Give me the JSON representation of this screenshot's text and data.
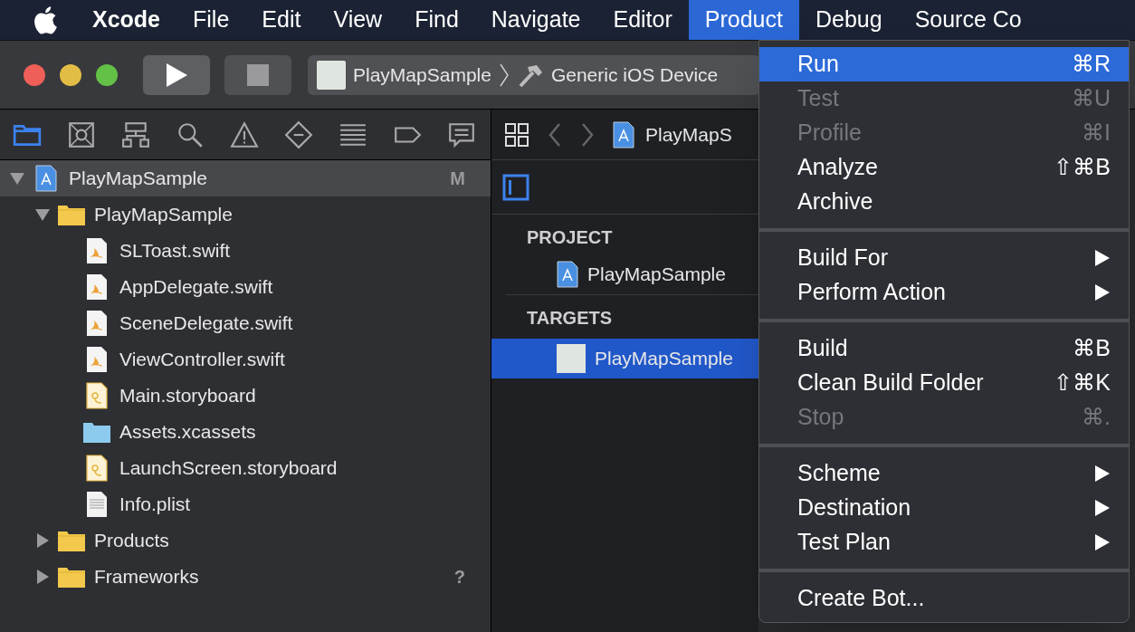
{
  "menu_bar": {
    "items": [
      {
        "label": "Xcode",
        "kind": "app",
        "selected": false
      },
      {
        "label": "File",
        "kind": "menu",
        "selected": false
      },
      {
        "label": "Edit",
        "kind": "menu",
        "selected": false
      },
      {
        "label": "View",
        "kind": "menu",
        "selected": false
      },
      {
        "label": "Find",
        "kind": "menu",
        "selected": false
      },
      {
        "label": "Navigate",
        "kind": "menu",
        "selected": false
      },
      {
        "label": "Editor",
        "kind": "menu",
        "selected": false
      },
      {
        "label": "Product",
        "kind": "menu",
        "selected": true
      },
      {
        "label": "Debug",
        "kind": "menu",
        "selected": false
      },
      {
        "label": "Source Co",
        "kind": "menu",
        "selected": false
      }
    ]
  },
  "toolbar": {
    "scheme": "PlayMapSample",
    "destination": "Generic iOS Device"
  },
  "navigator": {
    "tabs": [
      {
        "kind": "folder",
        "selected": true
      },
      {
        "kind": "source-control",
        "selected": false
      },
      {
        "kind": "hierarchy",
        "selected": false
      },
      {
        "kind": "search",
        "selected": false
      },
      {
        "kind": "warning",
        "selected": false
      },
      {
        "kind": "test",
        "selected": false
      },
      {
        "kind": "debug",
        "selected": false
      },
      {
        "kind": "breakpoint",
        "selected": false
      },
      {
        "kind": "report",
        "selected": false
      }
    ],
    "tree": [
      {
        "label": "PlayMapSample",
        "kind": "project",
        "badge": "M",
        "expanded": true,
        "selected": true,
        "children": [
          {
            "label": "PlayMapSample",
            "kind": "folder",
            "expanded": true,
            "selected": false,
            "children": [
              {
                "label": "SLToast.swift",
                "kind": "swift",
                "selected": false
              },
              {
                "label": "AppDelegate.swift",
                "kind": "swift",
                "selected": false
              },
              {
                "label": "SceneDelegate.swift",
                "kind": "swift",
                "selected": false
              },
              {
                "label": "ViewController.swift",
                "kind": "swift",
                "selected": false
              },
              {
                "label": "Main.storyboard",
                "kind": "storyboard",
                "selected": false
              },
              {
                "label": "Assets.xcassets",
                "kind": "assets",
                "selected": false
              },
              {
                "label": "LaunchScreen.storyboard",
                "kind": "storyboard",
                "selected": false
              },
              {
                "label": "Info.plist",
                "kind": "plist",
                "selected": false
              }
            ]
          },
          {
            "label": "Products",
            "kind": "folder",
            "expanded": false,
            "selected": false
          },
          {
            "label": "Frameworks",
            "kind": "folder",
            "badge": "?",
            "expanded": false,
            "selected": false
          }
        ]
      }
    ]
  },
  "editor": {
    "jump_bar": {
      "path": "PlayMapS"
    },
    "sections": [
      {
        "title": "PROJECT",
        "items": [
          {
            "label": "PlayMapSample",
            "kind": "project",
            "selected": false
          }
        ]
      },
      {
        "title": "TARGETS",
        "items": [
          {
            "label": "PlayMapSample",
            "kind": "target",
            "selected": true
          }
        ]
      }
    ]
  },
  "product_menu": {
    "items": [
      {
        "kind": "item",
        "label": "Run",
        "shortcut": "⌘R",
        "disabled": false,
        "selected": true,
        "submenu": false
      },
      {
        "kind": "item",
        "label": "Test",
        "shortcut": "⌘U",
        "disabled": true,
        "selected": false,
        "submenu": false
      },
      {
        "kind": "item",
        "label": "Profile",
        "shortcut": "⌘I",
        "disabled": true,
        "selected": false,
        "submenu": false
      },
      {
        "kind": "item",
        "label": "Analyze",
        "shortcut": "⇧⌘B",
        "disabled": false,
        "selected": false,
        "submenu": false
      },
      {
        "kind": "item",
        "label": "Archive",
        "disabled": false,
        "selected": false,
        "submenu": false
      },
      {
        "kind": "separator"
      },
      {
        "kind": "item",
        "label": "Build For",
        "disabled": false,
        "selected": false,
        "submenu": true
      },
      {
        "kind": "item",
        "label": "Perform Action",
        "disabled": false,
        "selected": false,
        "submenu": true
      },
      {
        "kind": "separator"
      },
      {
        "kind": "item",
        "label": "Build",
        "shortcut": "⌘B",
        "disabled": false,
        "selected": false,
        "submenu": false
      },
      {
        "kind": "item",
        "label": "Clean Build Folder",
        "shortcut": "⇧⌘K",
        "disabled": false,
        "selected": false,
        "submenu": false
      },
      {
        "kind": "item",
        "label": "Stop",
        "shortcut": "⌘.",
        "disabled": true,
        "selected": false,
        "submenu": false
      },
      {
        "kind": "separator"
      },
      {
        "kind": "item",
        "label": "Scheme",
        "disabled": false,
        "selected": false,
        "submenu": true
      },
      {
        "kind": "item",
        "label": "Destination",
        "disabled": false,
        "selected": false,
        "submenu": true
      },
      {
        "kind": "item",
        "label": "Test Plan",
        "disabled": false,
        "selected": false,
        "submenu": true
      },
      {
        "kind": "separator"
      },
      {
        "kind": "item",
        "label": "Create Bot...",
        "disabled": false,
        "selected": false,
        "submenu": false
      }
    ]
  }
}
